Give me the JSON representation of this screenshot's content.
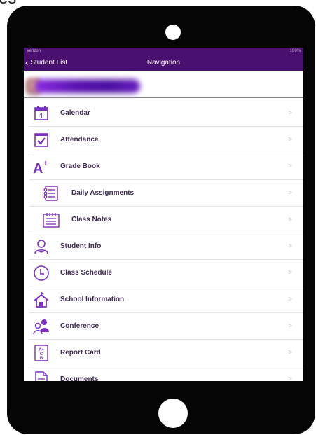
{
  "corner_text": "es",
  "statusbar": {
    "left": "Verizon",
    "right": "100%"
  },
  "navbar": {
    "back_label": "Student List",
    "title": "Navigation"
  },
  "colors": {
    "nav_purple": "#4a1070",
    "icon_purple": "#7b2fbf",
    "label_dark": "#3e2b52"
  },
  "menu": {
    "items": [
      {
        "label": "Calendar",
        "icon": "calendar-icon"
      },
      {
        "label": "Attendance",
        "icon": "attendance-checkbox-icon"
      },
      {
        "label": "Grade Book",
        "icon": "grade-a-plus-icon"
      },
      {
        "label": "Daily Assignments",
        "icon": "checklist-icon",
        "sub": true
      },
      {
        "label": "Class Notes",
        "icon": "notes-icon",
        "sub": true
      },
      {
        "label": "Student Info",
        "icon": "student-user-icon"
      },
      {
        "label": "Class Schedule",
        "icon": "clock-icon"
      },
      {
        "label": "School Information",
        "icon": "school-building-icon"
      },
      {
        "label": "Conference",
        "icon": "conference-people-icon"
      },
      {
        "label": "Report Card",
        "icon": "report-card-icon"
      },
      {
        "label": "Documents",
        "icon": "document-icon"
      }
    ],
    "chevron": ">"
  }
}
